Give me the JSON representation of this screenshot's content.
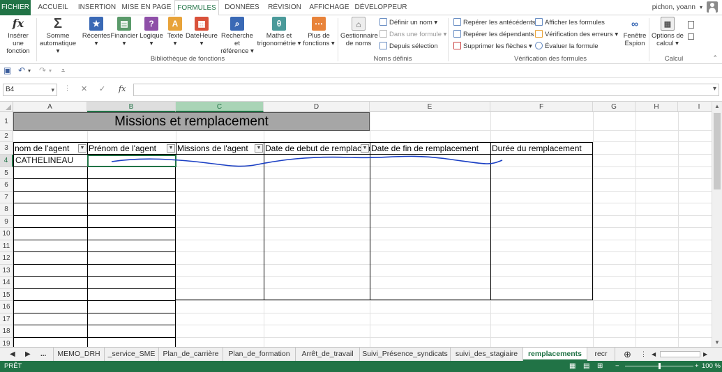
{
  "tabs": [
    "FICHIER",
    "ACCUEIL",
    "INSERTION",
    "MISE EN PAGE",
    "FORMULES",
    "DONNÉES",
    "RÉVISION",
    "AFFICHAGE",
    "DÉVELOPPEUR"
  ],
  "user": "pichon, yoann",
  "ribbon": {
    "insert_function": [
      "Insérer une",
      "fonction"
    ],
    "autosum": [
      "Somme",
      "automatique"
    ],
    "recent": "Récentes",
    "financial": "Financier",
    "logical": "Logique",
    "text": "Texte",
    "datetime": "DateHeure",
    "lookup": [
      "Recherche et",
      "référence"
    ],
    "math": [
      "Maths et",
      "trigonométrie"
    ],
    "more": [
      "Plus de",
      "fonctions"
    ],
    "library_label": "Bibliothèque de fonctions",
    "name_manager": [
      "Gestionnaire",
      "de noms"
    ],
    "define_name": "Définir un nom",
    "use_in_formula": "Dans une formule",
    "create_from_selection": "Depuis sélection",
    "names_label": "Noms définis",
    "trace_precedents": "Repérer les antécédents",
    "trace_dependents": "Repérer les dépendants",
    "remove_arrows": "Supprimer les flèches",
    "show_formulas": "Afficher les formules",
    "error_checking": "Vérification des erreurs",
    "evaluate_formula": "Évaluer la formule",
    "audit_label": "Vérification des formules",
    "watch_window": [
      "Fenêtre",
      "Espion"
    ],
    "calc_options": [
      "Options de",
      "calcul"
    ],
    "calc_label": "Calcul"
  },
  "formula_bar": {
    "name_box": "B4",
    "value": ""
  },
  "columns": [
    "A",
    "B",
    "C",
    "D",
    "E",
    "F",
    "G",
    "H",
    "I"
  ],
  "rows": [
    "1",
    "2",
    "3",
    "4",
    "5",
    "6",
    "7",
    "8",
    "9",
    "10",
    "11",
    "12",
    "13",
    "14",
    "15",
    "16",
    "17",
    "18",
    "19"
  ],
  "sheet": {
    "title": "Missions et remplacement",
    "headers": [
      "nom de l'agent",
      "Prénom de l'agent",
      "Missions de l'agent",
      "Date de debut de remplacement",
      "Date de fin de remplacement",
      "Durée du remplacement"
    ],
    "row4": {
      "A": "CATHELINEAU"
    }
  },
  "sheet_tabs": [
    "MEMO_DRH",
    "_service_SME",
    "Plan_de_carrière",
    "Plan_de_formation",
    "Arrêt_de_travail",
    "Suivi_Présence_syndicats",
    "suivi_des_stagiaire",
    "remplacements",
    "recr"
  ],
  "nav_ellipsis": "...",
  "status": {
    "ready": "PRÊT",
    "zoom": "100 %"
  },
  "colors": {
    "accent": "#217346",
    "ink": "#1a3fc4"
  }
}
